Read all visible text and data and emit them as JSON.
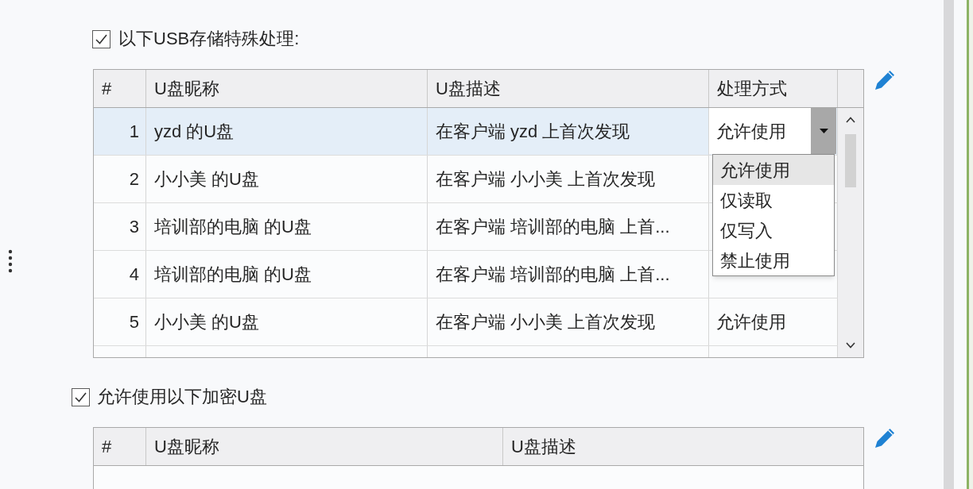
{
  "special_usb_section": {
    "checked": true,
    "label": "以下USB存储特殊处理:",
    "table": {
      "columns": [
        "#",
        "U盘昵称",
        "U盘描述",
        "处理方式"
      ],
      "rows": [
        {
          "number": "1",
          "nickname": "yzd 的U盘",
          "description": "在客户端 yzd 上首次发现",
          "method": "允许使用",
          "selected": true,
          "expanded": true
        },
        {
          "number": "2",
          "nickname": "小小美 的U盘",
          "description": "在客户端 小小美 上首次发现",
          "selected": false,
          "expanded": false
        },
        {
          "number": "3",
          "nickname": "培训部的电脑 的U盘",
          "description": "在客户端 培训部的电脑 上首...",
          "selected": false,
          "expanded": false
        },
        {
          "number": "4",
          "nickname": "培训部的电脑 的U盘",
          "description": "在客户端 培训部的电脑 上首...",
          "selected": false,
          "expanded": false
        },
        {
          "number": "5",
          "nickname": "小小美 的U盘",
          "description": "在客户端 小小美 上首次发现",
          "method": "允许使用",
          "selected": false,
          "expanded": false
        }
      ],
      "method_options": [
        {
          "label": "允许使用",
          "selected": true
        },
        {
          "label": "仅读取",
          "selected": false
        },
        {
          "label": "仅写入",
          "selected": false
        },
        {
          "label": "禁止使用",
          "selected": false
        }
      ]
    }
  },
  "encrypted_usb_section": {
    "checked": true,
    "label": "允许使用以下加密U盘",
    "table": {
      "columns": [
        "#",
        "U盘昵称",
        "U盘描述"
      ]
    }
  }
}
